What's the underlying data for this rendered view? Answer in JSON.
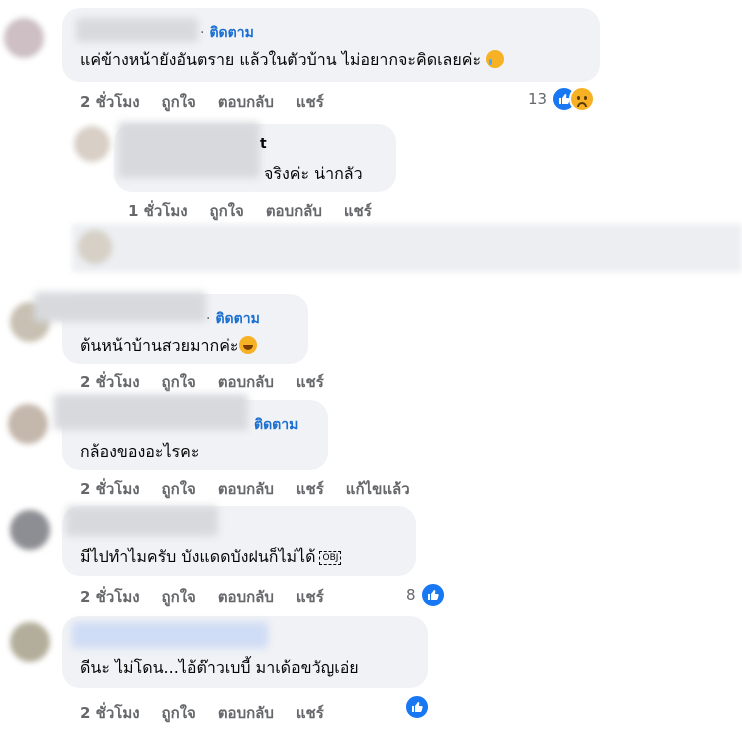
{
  "follow_label": "ติดตาม",
  "actions": {
    "time2": "2 ชั่วโมง",
    "time1": "1 ชั่วโมง",
    "like": "ถูกใจ",
    "reply": "ตอบกลับ",
    "share": "แชร์",
    "edited": "แก้ไขแล้ว"
  },
  "comments": [
    {
      "text": "แค่ข้างหน้ายังอันตราย แล้วในตัวบ้าน ไม่อยากจะคิดเลยค่ะ",
      "reactions": "13"
    },
    {
      "name_tail": "t",
      "text": "จริงค่ะ น่ากลัว"
    },
    {
      "text": "ต้นหน้าบ้านสวยมากค่ะ"
    },
    {
      "text": "กล้องของอะไรคะ"
    },
    {
      "text": "มีไปทำไมครับ บังแดดบังฝนก็ไม่ได้",
      "obj": "OBJ",
      "reactions": "8"
    },
    {
      "text": "ดีนะ ไม่โดน...ไอ้ต๊าวเบบี้ มาเด้อขวัญเอ่ย"
    }
  ],
  "colors": {
    "follow": "#1a6fd1",
    "bubble": "#f0f2f5",
    "action_text": "#65676b",
    "like_blue": "#1877f2"
  }
}
